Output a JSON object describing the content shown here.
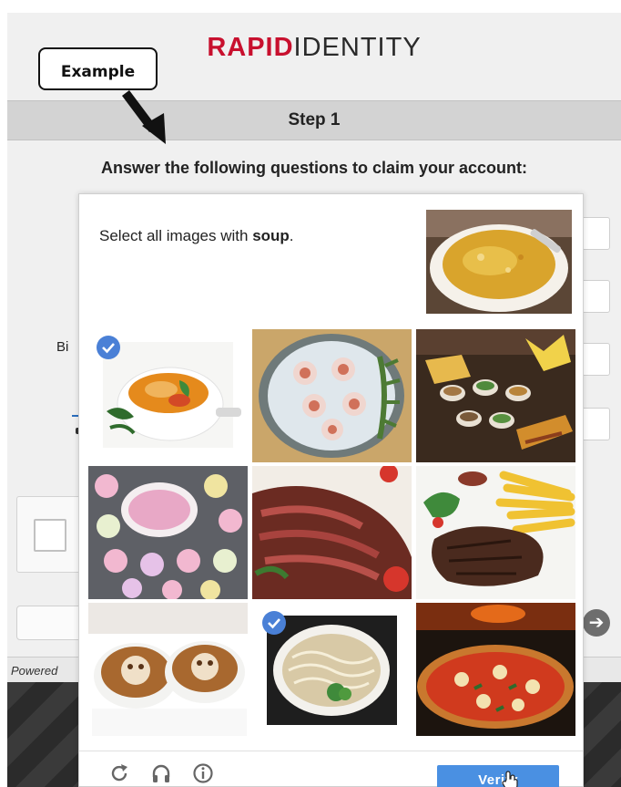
{
  "brand": {
    "part1": "RAPID",
    "part2": "IDENTITY"
  },
  "annotation": {
    "label": "Example"
  },
  "step": {
    "title": "Step 1"
  },
  "instructions": "Answer the following questions to claim your account:",
  "partial_label": "Bi",
  "footer": {
    "powered_text": "Powered"
  },
  "challenge": {
    "prompt_prefix": "Select all images with ",
    "prompt_target": "soup",
    "prompt_suffix": ".",
    "verify_label": "Verify",
    "tiles": [
      {
        "name": "soup-bowl",
        "selected": true
      },
      {
        "name": "seafood-cups",
        "selected": false
      },
      {
        "name": "tapas-platter",
        "selected": false
      },
      {
        "name": "cupcakes",
        "selected": false
      },
      {
        "name": "steak-slices",
        "selected": false
      },
      {
        "name": "steak-fries",
        "selected": false
      },
      {
        "name": "latte-art",
        "selected": false
      },
      {
        "name": "noodle-soup",
        "selected": true
      },
      {
        "name": "pizza",
        "selected": false
      }
    ],
    "footer_icons": [
      "reload-icon",
      "audio-icon",
      "info-icon"
    ]
  },
  "colors": {
    "brand_red": "#c8102e",
    "verify_blue": "#4a90e2",
    "check_blue": "#4a80d6"
  }
}
